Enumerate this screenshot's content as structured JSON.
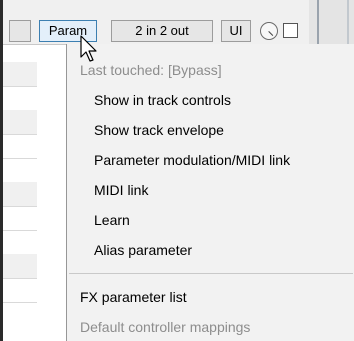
{
  "toolbar": {
    "param_label": "Param",
    "io_label": "2 in 2 out",
    "ui_label": "UI"
  },
  "menu": {
    "last_touched": "Last touched: [Bypass]",
    "items": [
      "Show in track controls",
      "Show track envelope",
      "Parameter modulation/MIDI link",
      "MIDI link",
      "Learn",
      "Alias parameter"
    ],
    "fx_parameter_list": "FX parameter list",
    "default_controller_mappings": "Default controller mappings"
  },
  "colors": {
    "menu_bg": "#f2f2f2",
    "disabled_text": "#8d8d8d",
    "active_button_border": "#3c7fb1"
  }
}
